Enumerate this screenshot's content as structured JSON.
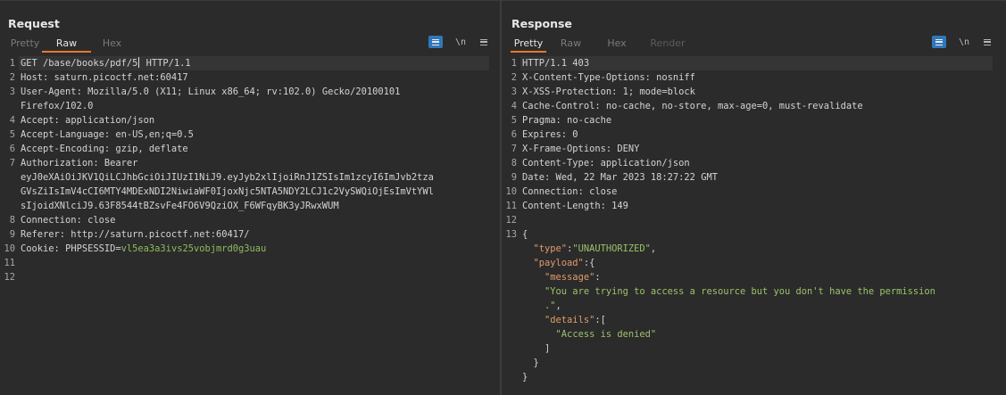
{
  "request": {
    "title": "Request",
    "tabs": [
      "Pretty",
      "Raw",
      "Hex"
    ],
    "active_tab": "Raw",
    "newline_toggle": "\\n",
    "lines": [
      {
        "n": "1",
        "parts": [
          {
            "t": "GET /base/books/pdf/5",
            "c": "val"
          },
          {
            "t": "CARET"
          },
          {
            "t": " HTTP/1.1",
            "c": "val"
          }
        ],
        "hl": true
      },
      {
        "n": "2",
        "parts": [
          {
            "t": "Host",
            "c": "key"
          },
          {
            "t": ": saturn.picoctf.net:60417",
            "c": "val"
          }
        ]
      },
      {
        "n": "3",
        "parts": [
          {
            "t": "User-Agent",
            "c": "key"
          },
          {
            "t": ": Mozilla/5.0 (X11; Linux x86_64; rv:102.0) Gecko/20100101",
            "c": "val"
          }
        ]
      },
      {
        "n": "",
        "parts": [
          {
            "t": "Firefox/102.0",
            "c": "val"
          }
        ]
      },
      {
        "n": "4",
        "parts": [
          {
            "t": "Accept",
            "c": "key"
          },
          {
            "t": ": application/json",
            "c": "val"
          }
        ]
      },
      {
        "n": "5",
        "parts": [
          {
            "t": "Accept-Language",
            "c": "key"
          },
          {
            "t": ": en-US,en;q=0.5",
            "c": "val"
          }
        ]
      },
      {
        "n": "6",
        "parts": [
          {
            "t": "Accept-Encoding",
            "c": "key"
          },
          {
            "t": ": gzip, deflate",
            "c": "val"
          }
        ]
      },
      {
        "n": "7",
        "parts": [
          {
            "t": "Authorization",
            "c": "key"
          },
          {
            "t": ": Bearer",
            "c": "val"
          }
        ]
      },
      {
        "n": "",
        "parts": [
          {
            "t": "eyJ0eXAiOiJKV1QiLCJhbGciOiJIUzI1NiJ9.eyJyb2xlIjoiRnJ1ZSIsIm1zcyI6ImJvb2tza",
            "c": "val"
          }
        ]
      },
      {
        "n": "",
        "parts": [
          {
            "t": "GVsZiIsImV4cCI6MTY4MDExNDI2NiwiaWF0IjoxNjc5NTA5NDY2LCJ1c2VySWQiOjEsImVtYWl",
            "c": "val"
          }
        ]
      },
      {
        "n": "",
        "parts": [
          {
            "t": "sIjoidXNlciJ9.63F8544tBZsvFe4FO6V9QziOX_F6WFqyBK3yJRwxWUM",
            "c": "val"
          }
        ]
      },
      {
        "n": "8",
        "parts": [
          {
            "t": "Connection",
            "c": "key"
          },
          {
            "t": ": close",
            "c": "val"
          }
        ]
      },
      {
        "n": "9",
        "parts": [
          {
            "t": "Referer",
            "c": "key"
          },
          {
            "t": ": http://saturn.picoctf.net:60417/",
            "c": "val"
          }
        ]
      },
      {
        "n": "10",
        "parts": [
          {
            "t": "Cookie",
            "c": "key"
          },
          {
            "t": ": ",
            "c": "val"
          },
          {
            "t": "PHPSESSID",
            "c": "cookie-name"
          },
          {
            "t": "=",
            "c": "cookie-eq"
          },
          {
            "t": "vl5ea3a3ivs25vobjmrd0g3uau",
            "c": "cookie-val"
          }
        ]
      },
      {
        "n": "11",
        "parts": []
      },
      {
        "n": "12",
        "parts": []
      }
    ]
  },
  "response": {
    "title": "Response",
    "tabs": [
      "Pretty",
      "Raw",
      "Hex",
      "Render"
    ],
    "active_tab": "Pretty",
    "newline_toggle": "\\n",
    "lines": [
      {
        "n": "1",
        "parts": [
          {
            "t": "HTTP/1.1 403",
            "c": "val"
          }
        ],
        "hl": true
      },
      {
        "n": "2",
        "parts": [
          {
            "t": "X-Content-Type-Options",
            "c": "key"
          },
          {
            "t": ": nosniff",
            "c": "val"
          }
        ]
      },
      {
        "n": "3",
        "parts": [
          {
            "t": "X-XSS-Protection",
            "c": "key"
          },
          {
            "t": ": 1; mode=block",
            "c": "val"
          }
        ]
      },
      {
        "n": "4",
        "parts": [
          {
            "t": "Cache-Control",
            "c": "key"
          },
          {
            "t": ": no-cache, no-store, max-age=0, must-revalidate",
            "c": "val"
          }
        ]
      },
      {
        "n": "5",
        "parts": [
          {
            "t": "Pragma",
            "c": "key"
          },
          {
            "t": ": no-cache",
            "c": "val"
          }
        ]
      },
      {
        "n": "6",
        "parts": [
          {
            "t": "Expires",
            "c": "key"
          },
          {
            "t": ": 0",
            "c": "val"
          }
        ]
      },
      {
        "n": "7",
        "parts": [
          {
            "t": "X-Frame-Options",
            "c": "key"
          },
          {
            "t": ": DENY",
            "c": "val"
          }
        ]
      },
      {
        "n": "8",
        "parts": [
          {
            "t": "Content-Type",
            "c": "key"
          },
          {
            "t": ": application/json",
            "c": "val"
          }
        ]
      },
      {
        "n": "9",
        "parts": [
          {
            "t": "Date",
            "c": "key"
          },
          {
            "t": ": Wed, 22 Mar 2023 18:27:22 GMT",
            "c": "val"
          }
        ]
      },
      {
        "n": "10",
        "parts": [
          {
            "t": "Connection",
            "c": "key"
          },
          {
            "t": ": close",
            "c": "val"
          }
        ]
      },
      {
        "n": "11",
        "parts": [
          {
            "t": "Content-Length",
            "c": "key"
          },
          {
            "t": ": 149",
            "c": "val"
          }
        ]
      },
      {
        "n": "12",
        "parts": []
      },
      {
        "n": "13",
        "parts": [
          {
            "t": "{",
            "c": "j-punct"
          }
        ]
      },
      {
        "n": "",
        "parts": [
          {
            "t": "  ",
            "c": "j-punct"
          },
          {
            "t": "\"type\"",
            "c": "j-key"
          },
          {
            "t": ":",
            "c": "j-punct"
          },
          {
            "t": "\"UNAUTHORIZED\"",
            "c": "j-str"
          },
          {
            "t": ",",
            "c": "j-punct"
          }
        ]
      },
      {
        "n": "",
        "parts": [
          {
            "t": "  ",
            "c": "j-punct"
          },
          {
            "t": "\"payload\"",
            "c": "j-key"
          },
          {
            "t": ":{",
            "c": "j-punct"
          }
        ]
      },
      {
        "n": "",
        "parts": [
          {
            "t": "    ",
            "c": "j-punct"
          },
          {
            "t": "\"message\"",
            "c": "j-key"
          },
          {
            "t": ":",
            "c": "j-punct"
          }
        ]
      },
      {
        "n": "",
        "parts": [
          {
            "t": "    ",
            "c": "j-punct"
          },
          {
            "t": "\"You are trying to access a resource but you don't have the permission",
            "c": "j-str"
          }
        ]
      },
      {
        "n": "",
        "parts": [
          {
            "t": "    ",
            "c": "j-punct"
          },
          {
            "t": ".\"",
            "c": "j-str"
          },
          {
            "t": ",",
            "c": "j-punct"
          }
        ]
      },
      {
        "n": "",
        "parts": [
          {
            "t": "    ",
            "c": "j-punct"
          },
          {
            "t": "\"details\"",
            "c": "j-key"
          },
          {
            "t": ":[",
            "c": "j-punct"
          }
        ]
      },
      {
        "n": "",
        "parts": [
          {
            "t": "      ",
            "c": "j-punct"
          },
          {
            "t": "\"Access is denied\"",
            "c": "j-str"
          }
        ]
      },
      {
        "n": "",
        "parts": [
          {
            "t": "    ]",
            "c": "j-punct"
          }
        ]
      },
      {
        "n": "",
        "parts": [
          {
            "t": "  }",
            "c": "j-punct"
          }
        ]
      },
      {
        "n": "",
        "parts": [
          {
            "t": "}",
            "c": "j-punct"
          }
        ]
      }
    ]
  },
  "layout_switch": {
    "icons": [
      "split-columns-icon",
      "split-rows-icon",
      "single-pane-icon"
    ],
    "active": 0
  },
  "colors": {
    "accent_tab": "#e8792f",
    "button_blue": "#2f77bb",
    "json_key": "#e09b6a",
    "json_string": "#9bc26a"
  }
}
